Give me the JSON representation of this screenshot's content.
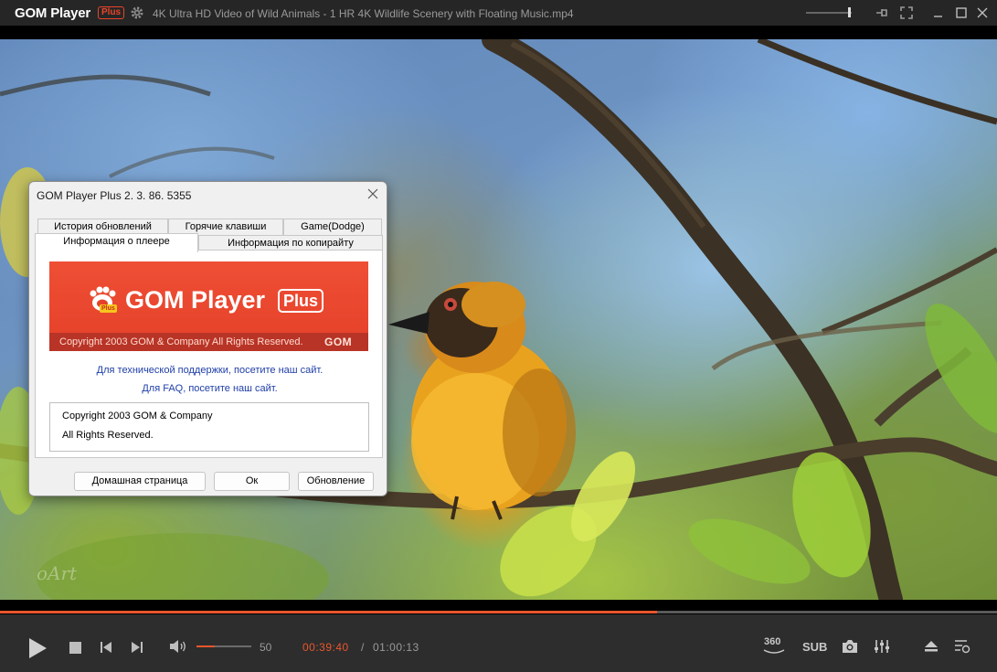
{
  "app": {
    "logo": "GOM Player",
    "logo_badge": "Plus",
    "file_title": "4K Ultra HD Video of Wild Animals - 1 HR 4K Wildlife Scenery with Floating Music.mp4"
  },
  "video": {
    "watermark": "oArt"
  },
  "dialog": {
    "title": "GOM Player Plus 2. 3. 86. 5355",
    "tabs_back": [
      "История обновлений",
      "Горячие клавиши",
      "Game(Dodge)"
    ],
    "tabs_front": [
      "Информация о плеере",
      "Информация по копирайту"
    ],
    "active_tab": "Информация о плеере",
    "banner": {
      "title": "GOM Player",
      "plus": "Plus",
      "logo_badge": "Plus",
      "copyright": "Copyright 2003 GOM & Company All Rights Reserved.",
      "brand": "GOM"
    },
    "links": {
      "support": "Для технической поддержки, посетите наш сайт.",
      "faq": "Для FAQ, посетите наш сайт."
    },
    "copyright_lines": [
      "Copyright 2003 GOM & Company",
      "All Rights Reserved."
    ],
    "buttons": {
      "home": "Домашная страница",
      "ok": "Ок",
      "update": "Обновление"
    }
  },
  "controls": {
    "volume": "50",
    "volume_level": 0.33,
    "current_time": "00:39:40",
    "separator": "/",
    "total_time": "01:00:13",
    "progress": 0.659,
    "badge_360": "360",
    "sub_label": "SUB"
  },
  "colors": {
    "accent": "#e8562d",
    "banner_red": "#e54029",
    "link_blue": "#1f3ea8"
  },
  "icons": [
    "gear-icon",
    "pin-icon",
    "fullscreen-icon",
    "minimize-icon",
    "maximize-icon",
    "close-icon",
    "play-icon",
    "stop-icon",
    "prev-icon",
    "next-icon",
    "speaker-icon",
    "camera-icon",
    "equalizer-icon",
    "eject-icon",
    "playlist-icon"
  ]
}
